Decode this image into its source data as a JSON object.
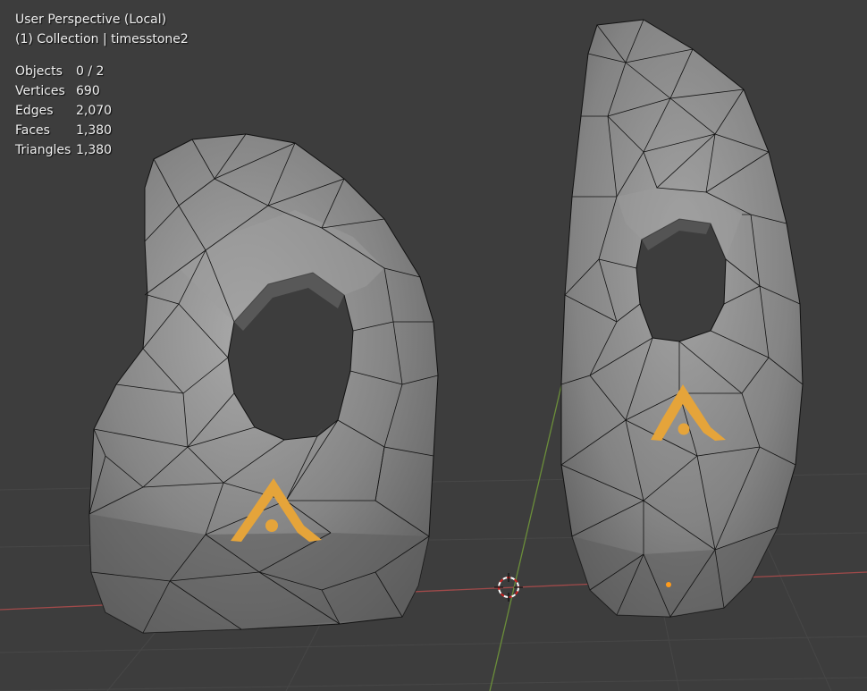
{
  "viewport": {
    "perspective_label": "User Perspective (Local)",
    "collection_label": "(1) Collection | timesstone2"
  },
  "statistics": [
    {
      "label": "Objects",
      "value": "0 / 2"
    },
    {
      "label": "Vertices",
      "value": "690"
    },
    {
      "label": "Edges",
      "value": "2,070"
    },
    {
      "label": "Faces",
      "value": "1,380"
    },
    {
      "label": "Triangles",
      "value": "1,380"
    }
  ],
  "colors": {
    "background": "#3d3d3d",
    "grid_line": "#474747",
    "x_axis": "#a14a4a",
    "y_axis": "#6b8e3a",
    "stone_base": "#8f8f8f",
    "emblem": "#e5a43a",
    "wireframe": "#101010"
  }
}
